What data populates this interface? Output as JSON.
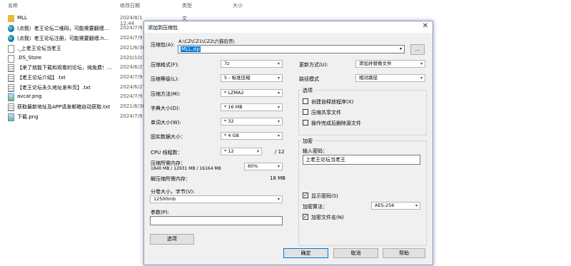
{
  "explorer": {
    "headers": {
      "name": "名称",
      "date": "修改日期",
      "type": "类型",
      "size": "大小"
    },
    "files": [
      {
        "name": "MLL",
        "icon": "folder-icon",
        "date": "2024/8/1 12:44",
        "type": "文件夹"
      },
      {
        "name": "(点我）老王论坛二维码，可能需要翻墙...",
        "icon": "edge-icon",
        "date": "2024/7/9"
      },
      {
        "name": "(点我）老王论坛注册，可能需要翻墙.h...",
        "icon": "edge-icon",
        "date": "2024/7/9"
      },
      {
        "name": "._上老王论坛当老王",
        "icon": "file-icon",
        "date": "2021/6/30"
      },
      {
        "name": ".DS_Store",
        "icon": "file-icon",
        "date": "2020/10/1"
      },
      {
        "name": "【来了就能下载和观看的论坛，纯免费！...",
        "icon": "text-file-icon",
        "date": "2024/6/27"
      },
      {
        "name": "【老王论坛介绍】.txt",
        "icon": "text-file-icon",
        "date": "2024/7/9"
      },
      {
        "name": "【老王论坛永久地址发布页】.txt",
        "icon": "text-file-icon",
        "date": "2024/6/27"
      },
      {
        "name": "avcar.png",
        "icon": "image-file-icon",
        "date": "2024/7/9"
      },
      {
        "name": "获取最新地址及APP请发邮箱自动获取.txt",
        "icon": "text-file-icon",
        "date": "2021/6/30"
      },
      {
        "name": "下载.png",
        "icon": "image-file-icon",
        "date": "2024/7/9"
      }
    ]
  },
  "dialog": {
    "title": "添加到压缩包",
    "archive": {
      "label": "压缩包(A):",
      "path": "A:\\CZ\\CZ1\\CZ2\\六猫后宫\\",
      "value": "MLL.zip",
      "browse_label": "..."
    },
    "left": {
      "format": {
        "label": "压缩格式(F):",
        "value": "7z"
      },
      "level": {
        "label": "压缩等级(L):",
        "value": "5 - 标准压缩"
      },
      "method": {
        "label": "压缩方法(M):",
        "value": "* LZMA2"
      },
      "dict": {
        "label": "字典大小(D):",
        "value": "* 16 MB"
      },
      "word": {
        "label": "单词大小(W):",
        "value": "* 32"
      },
      "solid": {
        "label": "固实数据大小：",
        "value": "* 4 GB"
      },
      "threads": {
        "label": "CPU 线程数：",
        "value": "* 12",
        "max": "/ 12"
      },
      "memory": {
        "label": "压缩所需内存：",
        "detail": "1840 MB / 12931 MB / 16164 MB",
        "value": "80%"
      },
      "decomp": {
        "label": "解压缩所需内存：",
        "value": "18 MB"
      },
      "split": {
        "label": "分卷大小，字节(V):",
        "value": "12500mb"
      },
      "params": {
        "label": "参数(P):",
        "value": ""
      },
      "options_button": "选项"
    },
    "right": {
      "update": {
        "label": "更新方式(U):",
        "value": "添加并替换文件"
      },
      "pathmode": {
        "label": "路径模式",
        "value": "相对路径"
      },
      "options_group": "选项",
      "options": [
        {
          "label": "创建自释放程序(X)",
          "checked": false
        },
        {
          "label": "压缩共享文件",
          "checked": false
        },
        {
          "label": "操作完成后删除源文件",
          "checked": false
        }
      ],
      "encryption_group": "加密",
      "password_label": "输入密码：",
      "password_value": "上老王论坛当老王",
      "show_password": {
        "label": "显示密码(S)",
        "checked": true
      },
      "enc_method": {
        "label": "加密算法：",
        "value": "AES-256"
      },
      "encrypt_names": {
        "label": "加密文件名(N)",
        "checked": true
      }
    },
    "buttons": {
      "ok": "确定",
      "cancel": "取消",
      "help": "帮助"
    },
    "close_glyph": "✕"
  }
}
